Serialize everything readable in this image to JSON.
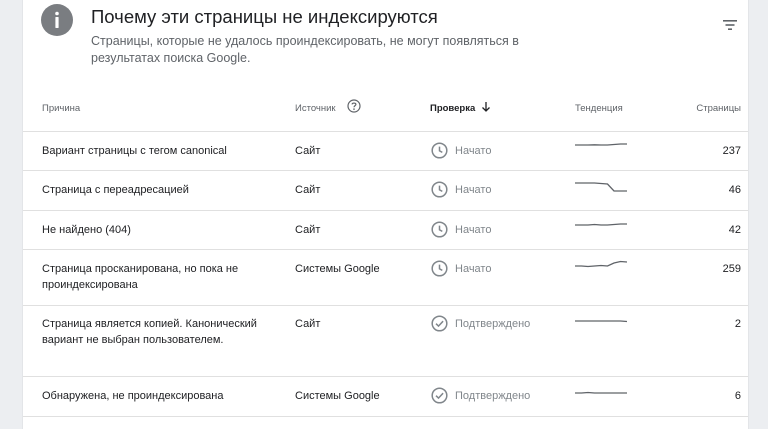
{
  "header": {
    "title": "Почему эти страницы не индексируются",
    "subtitle": "Страницы, которые не удалось проиндексировать, не могут появляться в результатах поиска Google.",
    "icon": "info-icon",
    "filter_icon": "filter-icon"
  },
  "table": {
    "columns": {
      "reason": "Причина",
      "source": "Источник",
      "validation": "Проверка",
      "trend": "Тенденция",
      "pages": "Страницы"
    },
    "sorted_column": "validation",
    "sort_direction": "descending",
    "rows": [
      {
        "reason": "Вариант страницы с тегом canonical",
        "source": "Сайт",
        "status": "Начато",
        "status_icon": "clock-icon",
        "trend": [
          0.2,
          0.2,
          0.2,
          0.18,
          0.2,
          0.2,
          0.15,
          0.1,
          0.1
        ],
        "pages": "237"
      },
      {
        "reason": "Страница с переадресацией",
        "source": "Сайт",
        "status": "Начато",
        "status_icon": "clock-icon",
        "trend": [
          0.1,
          0.1,
          0.1,
          0.1,
          0.15,
          0.2,
          0.9,
          0.9,
          0.9
        ],
        "pages": "46"
      },
      {
        "reason": "Не найдено (404)",
        "source": "Сайт",
        "status": "Начато",
        "status_icon": "clock-icon",
        "trend": [
          0.3,
          0.3,
          0.3,
          0.25,
          0.3,
          0.3,
          0.25,
          0.2,
          0.2
        ],
        "pages": "42"
      },
      {
        "reason": "Страница просканирована, но пока не проиндексирована",
        "source": "Системы Google",
        "status": "Начато",
        "status_icon": "clock-icon",
        "trend": [
          0.5,
          0.5,
          0.55,
          0.5,
          0.45,
          0.5,
          0.2,
          0.05,
          0.1
        ],
        "pages": "259"
      },
      {
        "reason": "Страница является копией. Канонический вариант не выбран пользователем.",
        "source": "Сайт",
        "status": "Подтверждено",
        "status_icon": "check-circle-icon",
        "trend": [
          0.5,
          0.5,
          0.5,
          0.5,
          0.5,
          0.5,
          0.5,
          0.5,
          0.55
        ],
        "pages": "2"
      },
      {
        "reason": "Обнаружена, не проиндексирована",
        "source": "Системы Google",
        "status": "Подтверждено",
        "status_icon": "check-circle-icon",
        "trend": [
          0.5,
          0.5,
          0.45,
          0.5,
          0.5,
          0.5,
          0.5,
          0.5,
          0.5
        ],
        "pages": "6"
      }
    ]
  },
  "colors": {
    "status_icon": "#80868b",
    "trend_line": "#5f6368",
    "divider": "#e0e0e0"
  }
}
